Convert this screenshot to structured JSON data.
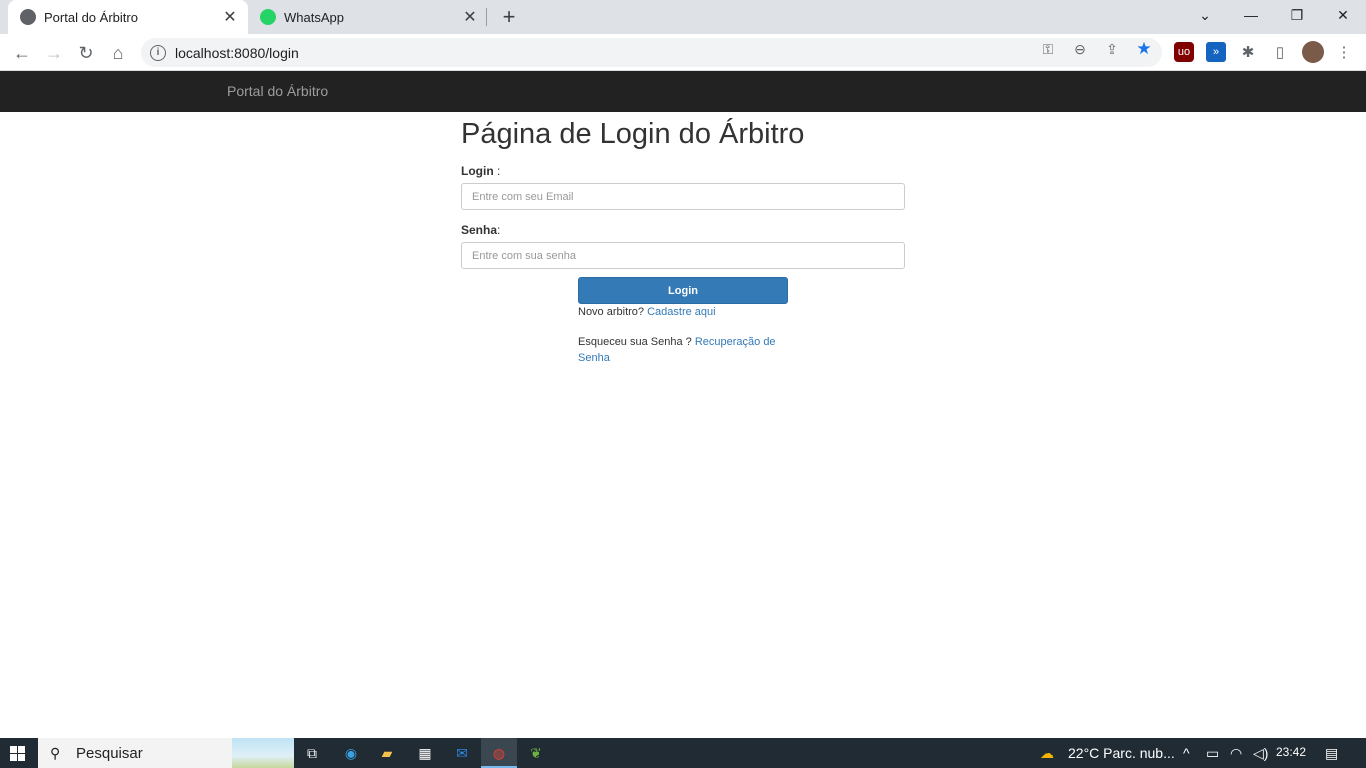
{
  "browser": {
    "tabs": [
      {
        "title": "Portal do Árbitro",
        "active": true
      },
      {
        "title": "WhatsApp",
        "active": false
      }
    ],
    "address": "localhost:8080/login",
    "close_glyph": "✕",
    "newtab_glyph": "+"
  },
  "page": {
    "brand": "Portal do Árbitro",
    "heading": "Página de Login do Árbitro",
    "login_label": "Login",
    "senha_label": "Senha",
    "colon": ":",
    "login_colon": " :",
    "email_placeholder": "Entre com seu Email",
    "password_placeholder": "Entre com sua senha",
    "login_button": "Login",
    "new_referee_text": "Novo arbitro?",
    "register_link": "Cadastre aqui",
    "forgot_text": "Esqueceu sua Senha ?",
    "recovery_link": "Recuperação de Senha"
  },
  "taskbar": {
    "search_text": "Pesquisar",
    "weather": "22°C  Parc. nub...",
    "time": "23:42"
  },
  "colors": {
    "navbar": "#222222",
    "primary": "#337ab7",
    "whatsapp": "#25d366"
  }
}
